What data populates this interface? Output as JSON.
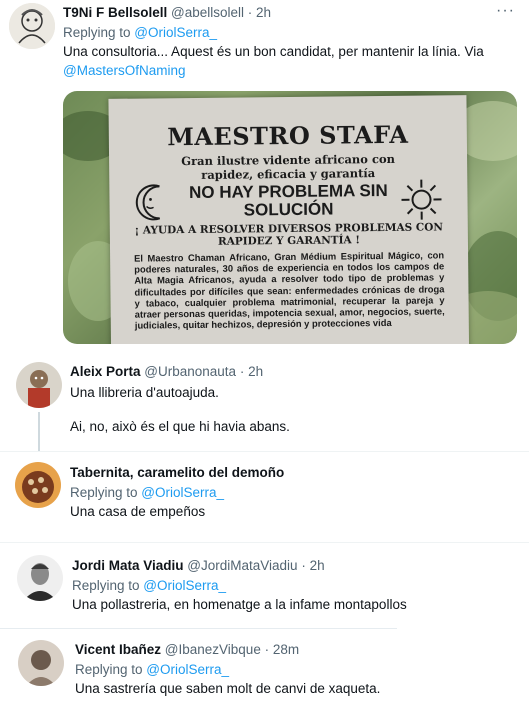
{
  "tweets": [
    {
      "name": "T9Ni F Bellsolell",
      "handle": "@abellsolell",
      "sep": " · ",
      "time": "2h",
      "replying_prefix": "Replying to ",
      "replying_to": "@OriolSerra_",
      "text_line1": "Una consultoria... Aquest és un bon candidat, per mantenir la línia. Via",
      "text_link": "@MastersOfNaming",
      "more": "···"
    },
    {
      "name": "Aleix Porta",
      "handle": "@Urbanonauta",
      "sep": " · ",
      "time": "2h",
      "text_line1": "Una llibreria d'autoajuda.",
      "text_line2": "Ai, no, això és el que hi havia abans."
    },
    {
      "name": "Tabernita, caramelito del demoño",
      "replying_prefix": "Replying to ",
      "replying_to": "@OriolSerra_",
      "text_line1": "Una casa de empeños"
    },
    {
      "name": "Jordi Mata Viadiu",
      "handle": "@JordiMataViadiu",
      "sep": " · ",
      "time": "2h",
      "replying_prefix": "Replying to ",
      "replying_to": "@OriolSerra_",
      "text_line1": "Una pollastreria, en homenatge a la infame montapollos"
    },
    {
      "name": "Vicent Ibañez",
      "handle": "@IbanezVibque",
      "sep": " · ",
      "time": "28m",
      "replying_prefix": "Replying to ",
      "replying_to": "@OriolSerra_",
      "text_line1": "Una sastrería que saben molt de canvi de xaqueta."
    }
  ],
  "poster": {
    "title": "MAESTRO STAFA",
    "subtitle": "Gran ilustre vidente africano con rapidez, eficacia y garantía",
    "headline": "NO HAY PROBLEMA SIN SOLUCIÓN",
    "ayuda": "¡ AYUDA A RESOLVER DIVERSOS PROBLEMAS CON RAPIDEZ Y GARANTÍA !",
    "body": "El Maestro Chaman Africano, Gran Médium Espiritual Mágico, con poderes naturales, 30 años de experiencia en todos los campos de Alta Magia Africanos, ayuda a resolver todo tipo de problemas y dificultades por difíciles que sean: enfermedades crónicas de droga y tabaco, cualquier problema matrimonial, recuperar la pareja y atraer personas queridas, impotencia sexual, amor, negocios, suerte, judiciales, quitar hechizos, depresión y protecciones vida"
  },
  "colors": {
    "link": "#1d9bf0",
    "meta": "#536471",
    "divider": "#eff3f4"
  }
}
